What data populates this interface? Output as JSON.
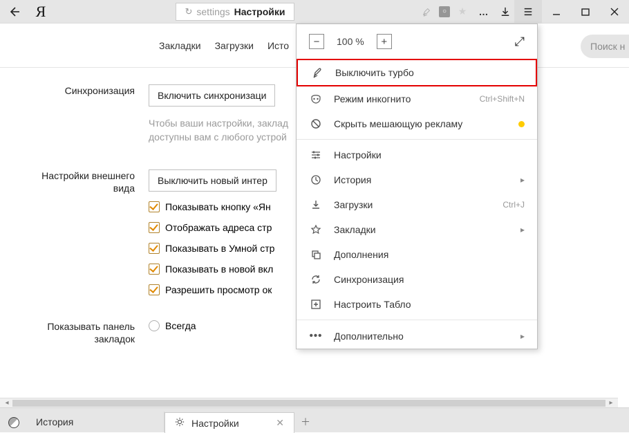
{
  "titlebar": {
    "logo": "Я",
    "tab_path": "settings",
    "tab_title": "Настройки"
  },
  "navstrip": {
    "items": [
      "Закладки",
      "Загрузки",
      "Исто"
    ],
    "search_placeholder": "Поиск н"
  },
  "sync": {
    "label": "Синхронизация",
    "button": "Включить синхронизаци",
    "hint1": "Чтобы ваши настройки, заклад",
    "hint2": "доступны вам с любого устрой"
  },
  "appearance": {
    "label1": "Настройки внешнего",
    "label2": "вида",
    "button": "Выключить новый интер",
    "cb1": "Показывать кнопку «Ян",
    "cb2": "Отображать адреса стр",
    "cb3": "Показывать в Умной стр",
    "cb4": "Показывать в новой вкл",
    "cb5": "Разрешить просмотр ок"
  },
  "bookbar": {
    "label1": "Показывать панель",
    "label2": "закладок",
    "opt1": "Всегда"
  },
  "menu": {
    "zoom_pct": "100 %",
    "turbo": "Выключить турбо",
    "incognito": "Режим инкогнито",
    "incognito_sc": "Ctrl+Shift+N",
    "hide_ads": "Скрыть мешающую рекламу",
    "settings": "Настройки",
    "history": "История",
    "downloads": "Загрузки",
    "downloads_sc": "Ctrl+J",
    "bookmarks": "Закладки",
    "addons": "Дополнения",
    "sync": "Синхронизация",
    "tablo": "Настроить Табло",
    "more": "Дополнительно"
  },
  "bottom": {
    "hist": "История",
    "settings": "Настройки"
  }
}
